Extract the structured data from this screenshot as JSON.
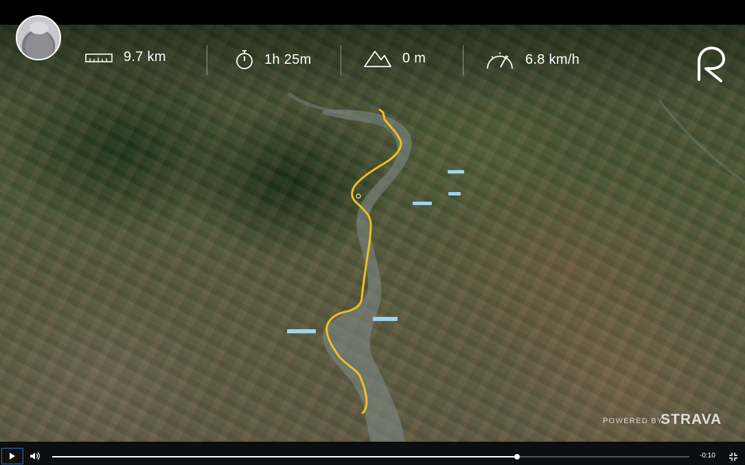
{
  "hud": {
    "stats": [
      {
        "icon": "ruler-icon",
        "value": "9.7 km"
      },
      {
        "icon": "stopwatch-icon",
        "value": "1h 25m"
      },
      {
        "icon": "mountain-icon",
        "value": "0 m"
      },
      {
        "icon": "speedometer-icon",
        "value": "6.8 km/h"
      }
    ],
    "logo_icon": "relive-logo"
  },
  "branding": {
    "powered_by": "POWERED BY",
    "provider": "STRAVA"
  },
  "colors": {
    "route": "#f0c020",
    "progress_accent": "#2c6fc7"
  },
  "player": {
    "state": "paused",
    "time_remaining": "-0:10",
    "progress": 0.73
  }
}
